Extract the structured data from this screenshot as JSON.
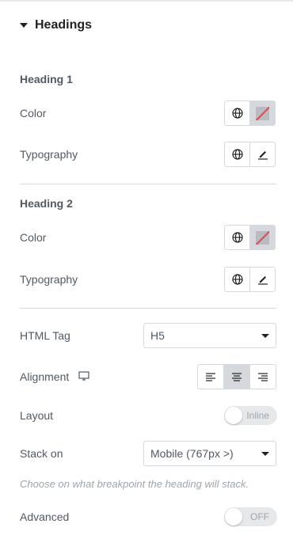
{
  "section": {
    "title": "Headings",
    "caret_icon": "caret-down-icon"
  },
  "heading1": {
    "title": "Heading 1",
    "color_label": "Color",
    "typography_label": "Typography"
  },
  "heading2": {
    "title": "Heading 2",
    "color_label": "Color",
    "typography_label": "Typography"
  },
  "html_tag": {
    "label": "HTML Tag",
    "value": "H5"
  },
  "alignment": {
    "label": "Alignment",
    "device_icon": "desktop-icon",
    "options": [
      "align-left",
      "align-center",
      "align-right"
    ],
    "selected": "align-center"
  },
  "layout": {
    "label": "Layout",
    "toggle_text": "Inline",
    "enabled": false
  },
  "stack_on": {
    "label": "Stack on",
    "value": "Mobile (767px >)",
    "help": "Choose on what breakpoint the heading will stack."
  },
  "advanced": {
    "label": "Advanced",
    "toggle_text": "OFF",
    "enabled": false
  },
  "colors": {
    "text": "#515962",
    "border": "#d5d8dc",
    "active_cell": "#d5d8dc",
    "muted": "#9da5ae",
    "strike": "#e2464f"
  }
}
